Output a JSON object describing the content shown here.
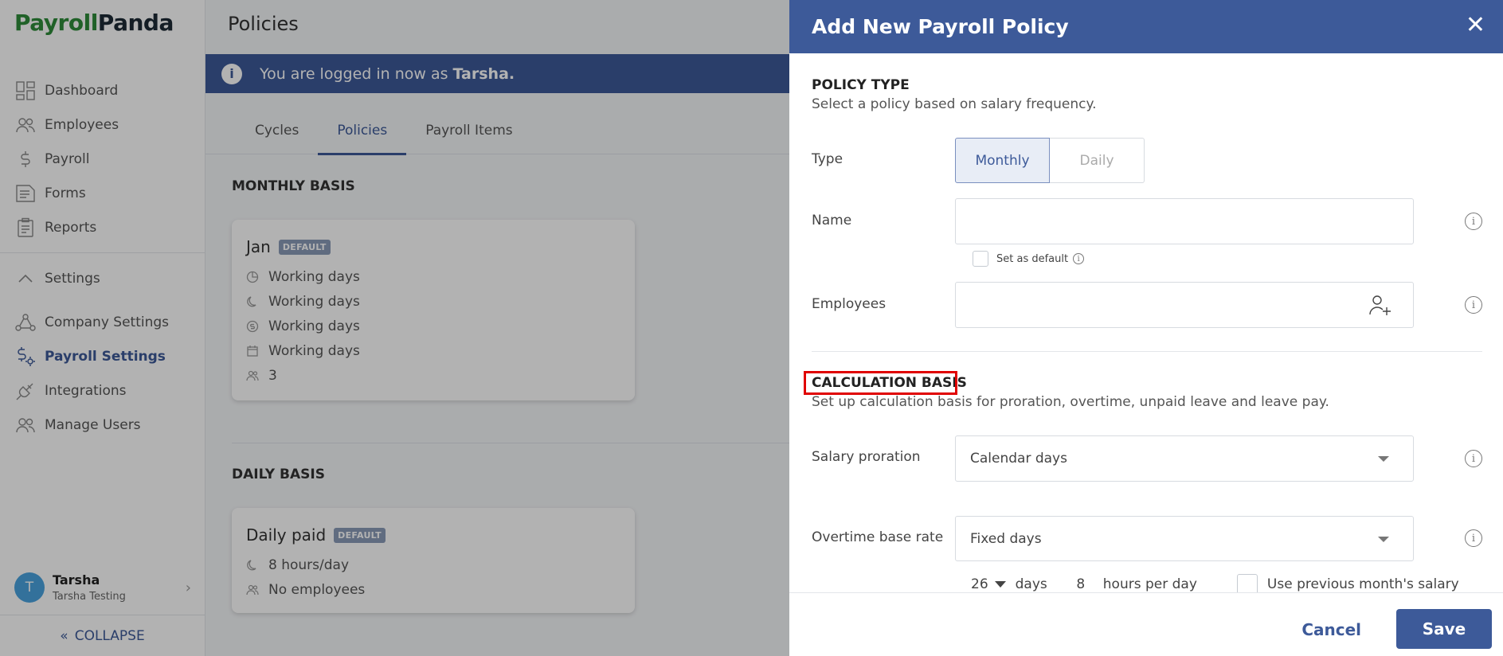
{
  "logo": {
    "part1": "Payroll",
    "part2": "Panda"
  },
  "sidebar": {
    "items": [
      {
        "label": "Dashboard",
        "icon": "dashboard-icon"
      },
      {
        "label": "Employees",
        "icon": "users-icon"
      },
      {
        "label": "Payroll",
        "icon": "dollar-icon"
      },
      {
        "label": "Forms",
        "icon": "form-icon"
      },
      {
        "label": "Reports",
        "icon": "clipboard-icon"
      }
    ],
    "settings_label": "Settings",
    "settings_items": [
      {
        "label": "Company Settings",
        "icon": "company-icon"
      },
      {
        "label": "Payroll Settings",
        "icon": "payroll-settings-icon"
      },
      {
        "label": "Integrations",
        "icon": "plug-icon"
      },
      {
        "label": "Manage Users",
        "icon": "manage-users-icon"
      }
    ],
    "user": {
      "initial": "T",
      "name": "Tarsha",
      "sub": "Tarsha Testing"
    },
    "collapse_label": "COLLAPSE"
  },
  "main": {
    "title": "Policies",
    "banner": {
      "text": "You are logged in now as",
      "user": "Tarsha."
    },
    "tabs": [
      "Cycles",
      "Policies",
      "Payroll Items"
    ],
    "monthly": {
      "heading": "MONTHLY BASIS",
      "card": {
        "title": "Jan",
        "badge": "DEFAULT",
        "lines": [
          "Working days",
          "Working days",
          "Working days",
          "Working days",
          "3"
        ]
      }
    },
    "daily": {
      "heading": "DAILY BASIS",
      "card": {
        "title": "Daily paid",
        "badge": "DEFAULT",
        "lines": [
          "8 hours/day",
          "No employees"
        ]
      }
    }
  },
  "drawer": {
    "title": "Add New Payroll Policy",
    "close": "✕",
    "policy_type": {
      "title": "POLICY TYPE",
      "sub": "Select a policy based on salary frequency."
    },
    "type_label": "Type",
    "type_options": [
      "Monthly",
      "Daily"
    ],
    "name_label": "Name",
    "name_value": "",
    "default_label": "Set as default",
    "employees_label": "Employees",
    "calc": {
      "title": "CALCULATION BASIS",
      "sub": "Set up calculation basis for proration, overtime, unpaid leave and leave pay."
    },
    "salary_proration_label": "Salary proration",
    "salary_proration_value": "Calendar days",
    "overtime_label": "Overtime base rate",
    "overtime_value": "Fixed days",
    "days_value": "26",
    "days_label": "days",
    "hours_value": "8",
    "hours_label": "hours per day",
    "prev_salary_label": "Use previous month's salary",
    "cancel": "Cancel",
    "save": "Save"
  },
  "colors": {
    "accent": "#3d5a99",
    "logo_green": "#2e8b3a",
    "highlight": "#e00000"
  }
}
